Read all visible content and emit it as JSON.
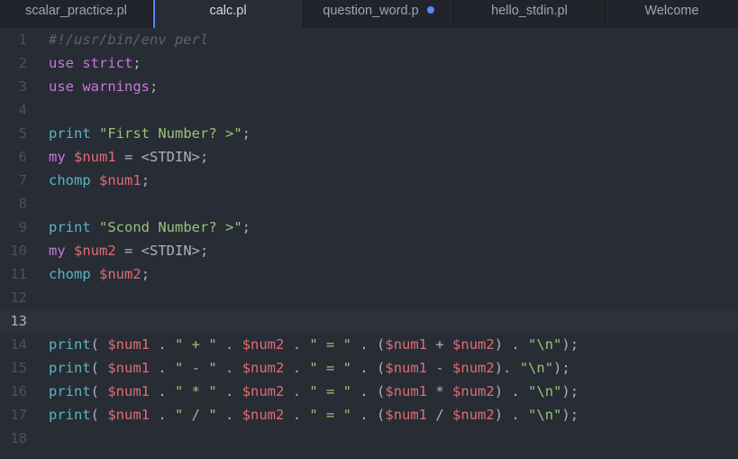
{
  "tabs": [
    {
      "label": "scalar_practice.pl"
    },
    {
      "label": "calc.pl"
    },
    {
      "label": "question_word.p"
    },
    {
      "label": "hello_stdin.pl"
    },
    {
      "label": "Welcome"
    }
  ],
  "editor": {
    "current_line": 13,
    "lines": [
      {
        "n": "1",
        "tokens": [
          [
            "comment",
            "#!/usr/bin/env perl"
          ]
        ]
      },
      {
        "n": "2",
        "tokens": [
          [
            "kw",
            "use"
          ],
          [
            "pl",
            " "
          ],
          [
            "kw",
            "strict"
          ],
          [
            "pl",
            ";"
          ]
        ]
      },
      {
        "n": "3",
        "tokens": [
          [
            "kw",
            "use"
          ],
          [
            "pl",
            " "
          ],
          [
            "kw",
            "warnings"
          ],
          [
            "pl",
            ";"
          ]
        ]
      },
      {
        "n": "4",
        "tokens": []
      },
      {
        "n": "5",
        "tokens": [
          [
            "fn",
            "print"
          ],
          [
            "pl",
            " "
          ],
          [
            "str",
            "\"First Number? >\""
          ],
          [
            "pl",
            ";"
          ]
        ]
      },
      {
        "n": "6",
        "tokens": [
          [
            "kw",
            "my"
          ],
          [
            "pl",
            " "
          ],
          [
            "var",
            "$num1"
          ],
          [
            "pl",
            " = <STDIN>;"
          ]
        ]
      },
      {
        "n": "7",
        "tokens": [
          [
            "fn",
            "chomp"
          ],
          [
            "pl",
            " "
          ],
          [
            "var",
            "$num1"
          ],
          [
            "pl",
            ";"
          ]
        ]
      },
      {
        "n": "8",
        "tokens": []
      },
      {
        "n": "9",
        "tokens": [
          [
            "fn",
            "print"
          ],
          [
            "pl",
            " "
          ],
          [
            "str",
            "\"Scond Number? >\""
          ],
          [
            "pl",
            ";"
          ]
        ]
      },
      {
        "n": "10",
        "tokens": [
          [
            "kw",
            "my"
          ],
          [
            "pl",
            " "
          ],
          [
            "var",
            "$num2"
          ],
          [
            "pl",
            " = <STDIN>;"
          ]
        ]
      },
      {
        "n": "11",
        "tokens": [
          [
            "fn",
            "chomp"
          ],
          [
            "pl",
            " "
          ],
          [
            "var",
            "$num2"
          ],
          [
            "pl",
            ";"
          ]
        ]
      },
      {
        "n": "12",
        "tokens": []
      },
      {
        "n": "13",
        "tokens": []
      },
      {
        "n": "14",
        "tokens": [
          [
            "fn",
            "print"
          ],
          [
            "pl",
            "( "
          ],
          [
            "var",
            "$num1"
          ],
          [
            "pl",
            " . "
          ],
          [
            "str",
            "\" + \""
          ],
          [
            "pl",
            " . "
          ],
          [
            "var",
            "$num2"
          ],
          [
            "pl",
            " . "
          ],
          [
            "str",
            "\" = \""
          ],
          [
            "pl",
            " . ("
          ],
          [
            "var",
            "$num1"
          ],
          [
            "pl",
            " + "
          ],
          [
            "var",
            "$num2"
          ],
          [
            "pl",
            ") . "
          ],
          [
            "str",
            "\"\\n\""
          ],
          [
            "pl",
            ");"
          ]
        ]
      },
      {
        "n": "15",
        "tokens": [
          [
            "fn",
            "print"
          ],
          [
            "pl",
            "( "
          ],
          [
            "var",
            "$num1"
          ],
          [
            "pl",
            " . "
          ],
          [
            "str",
            "\" - \""
          ],
          [
            "pl",
            " . "
          ],
          [
            "var",
            "$num2"
          ],
          [
            "pl",
            " . "
          ],
          [
            "str",
            "\" = \""
          ],
          [
            "pl",
            " . ("
          ],
          [
            "var",
            "$num1"
          ],
          [
            "pl",
            " - "
          ],
          [
            "var",
            "$num2"
          ],
          [
            "pl",
            "). "
          ],
          [
            "str",
            "\"\\n\""
          ],
          [
            "pl",
            ");"
          ]
        ]
      },
      {
        "n": "16",
        "tokens": [
          [
            "fn",
            "print"
          ],
          [
            "pl",
            "( "
          ],
          [
            "var",
            "$num1"
          ],
          [
            "pl",
            " . "
          ],
          [
            "str",
            "\" * \""
          ],
          [
            "pl",
            " . "
          ],
          [
            "var",
            "$num2"
          ],
          [
            "pl",
            " . "
          ],
          [
            "str",
            "\" = \""
          ],
          [
            "pl",
            " . ("
          ],
          [
            "var",
            "$num1"
          ],
          [
            "pl",
            " * "
          ],
          [
            "var",
            "$num2"
          ],
          [
            "pl",
            ") . "
          ],
          [
            "str",
            "\"\\n\""
          ],
          [
            "pl",
            ");"
          ]
        ]
      },
      {
        "n": "17",
        "tokens": [
          [
            "fn",
            "print"
          ],
          [
            "pl",
            "( "
          ],
          [
            "var",
            "$num1"
          ],
          [
            "pl",
            " . "
          ],
          [
            "str",
            "\" / \""
          ],
          [
            "pl",
            " . "
          ],
          [
            "var",
            "$num2"
          ],
          [
            "pl",
            " . "
          ],
          [
            "str",
            "\" = \""
          ],
          [
            "pl",
            " . ("
          ],
          [
            "var",
            "$num1"
          ],
          [
            "pl",
            " / "
          ],
          [
            "var",
            "$num2"
          ],
          [
            "pl",
            ") . "
          ],
          [
            "str",
            "\"\\n\""
          ],
          [
            "pl",
            ");"
          ]
        ]
      },
      {
        "n": "18",
        "tokens": []
      }
    ]
  }
}
